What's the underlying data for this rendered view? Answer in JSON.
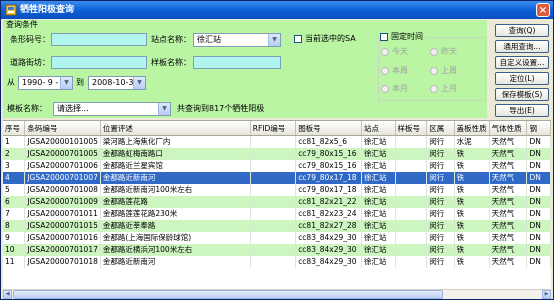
{
  "window": {
    "title": "牺牲阳极查询",
    "close_glyph": "×"
  },
  "conditions": {
    "group_label": "查询条件",
    "barcode_label": "条形码号：",
    "barcode_value": "",
    "station_label": "站点名称：",
    "station_value": "徐汇站",
    "current_sa_label": "当前选中的SA",
    "road_label": "道路街坊：",
    "road_value": "",
    "sample_label": "样板名称：",
    "sample_value": "",
    "from_label": "从",
    "from_date": "1990- 9 - 1",
    "to_label": "到",
    "to_date": "2008-10-30",
    "fixed_time_label": "固定时间",
    "radios": [
      {
        "label": "今天"
      },
      {
        "label": "昨天"
      },
      {
        "label": "本周"
      },
      {
        "label": "上周"
      },
      {
        "label": "本月"
      },
      {
        "label": "上月"
      }
    ],
    "template_label": "模板名称：",
    "template_value": "请选择...",
    "result_text": "共查询到817个牺牲阳极"
  },
  "buttons": {
    "query": "查询(Q)",
    "general_query": "通用查询...",
    "custom_settings": "自定义设置...",
    "locate": "定位(L)",
    "save_template": "保存模板(S)",
    "export": "导出(E)"
  },
  "table": {
    "columns": [
      "序号",
      "条码编号",
      "位置评述",
      "RFID编号",
      "图板号",
      "站点",
      "样板号",
      "区属",
      "盖板性质",
      "气体性质",
      "钢"
    ],
    "rows": [
      [
        "1",
        "JGSA20000101005",
        "梁河路上海焦化厂内",
        "",
        "cc81_82x5_6",
        "徐汇站",
        "",
        "闵行",
        "水泥",
        "天然气",
        "DN"
      ],
      [
        "2",
        "JGSA20000701005",
        "金都路虹梅南路口",
        "",
        "cc79_80x15_16",
        "徐汇站",
        "",
        "闵行",
        "铁",
        "天然气",
        "DN"
      ],
      [
        "3",
        "JGSA20000701006",
        "金都路近兰星宾馆",
        "",
        "cc79_80x15_16",
        "徐汇站",
        "",
        "闵行",
        "铁",
        "天然气",
        "DN"
      ],
      [
        "4",
        "JGSA20000701007",
        "金都路近新南河",
        "",
        "cc79_80x17_18",
        "徐汇站",
        "",
        "闵行",
        "铁",
        "天然气",
        "DN"
      ],
      [
        "5",
        "JGSA20000701008",
        "金都路近新南河100米左右",
        "",
        "cc79_80x17_18",
        "徐汇站",
        "",
        "闵行",
        "铁",
        "天然气",
        "DN"
      ],
      [
        "6",
        "JGSA20000701009",
        "金都路莲花路",
        "",
        "cc81_82x21_22",
        "徐汇站",
        "",
        "闵行",
        "铁",
        "天然气",
        "DN"
      ],
      [
        "7",
        "JGSA20000701011",
        "金都路莲莲花路230米",
        "",
        "cc81_82x23_24",
        "徐汇站",
        "",
        "闵行",
        "铁",
        "天然气",
        "DN"
      ],
      [
        "8",
        "JGSA20000701015",
        "金都路近莘奉路",
        "",
        "cc81_82x27_28",
        "徐汇站",
        "",
        "闵行",
        "铁",
        "天然气",
        "DN"
      ],
      [
        "9",
        "JGSA20000701016",
        "金都路(上海国际保龄球馆)",
        "",
        "cc83_84x29_30",
        "徐汇站",
        "",
        "闵行",
        "铁",
        "天然气",
        "DN"
      ],
      [
        "10",
        "JGSA20000701017",
        "金都路近横浜河100米左右",
        "",
        "cc83_84x29_30",
        "徐汇站",
        "",
        "闵行",
        "铁",
        "天然气",
        "DN"
      ],
      [
        "11",
        "JGSA20000701018",
        "金都路近新南河",
        "",
        "cc83_84x29_30",
        "徐汇站",
        "",
        "闵行",
        "铁",
        "天然气",
        "DN"
      ]
    ],
    "selected_index": 3
  }
}
